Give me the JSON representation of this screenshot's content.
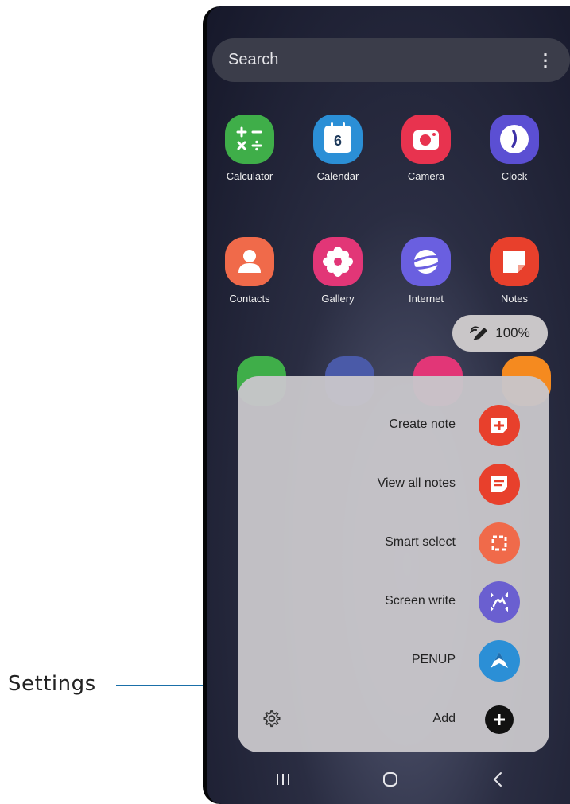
{
  "annotation": {
    "label": "Settings",
    "line_color": "#1a6fa8"
  },
  "search": {
    "placeholder": "Search",
    "more_icon": "more-vert-icon"
  },
  "apps": [
    {
      "label": "Calculator",
      "icon": "calculator-icon",
      "color": "#3fae49"
    },
    {
      "label": "Calendar",
      "icon": "calendar-icon",
      "color": "#2b8fd6",
      "day": "6"
    },
    {
      "label": "Camera",
      "icon": "camera-icon",
      "color": "#e8334f"
    },
    {
      "label": "Clock",
      "icon": "clock-icon",
      "color": "#5b4fd3"
    },
    {
      "label": "Contacts",
      "icon": "contacts-icon",
      "color": "#f06a4a"
    },
    {
      "label": "Gallery",
      "icon": "gallery-icon",
      "color": "#e23677"
    },
    {
      "label": "Internet",
      "icon": "internet-icon",
      "color": "#6a5fe0"
    },
    {
      "label": "Notes",
      "icon": "notes-icon",
      "color": "#e8402c"
    }
  ],
  "spen_battery": {
    "icon": "s-pen-icon",
    "value": "100%"
  },
  "air_command": {
    "items": [
      {
        "label": "Create note",
        "icon": "create-note-icon",
        "color": "#e8402c"
      },
      {
        "label": "View all notes",
        "icon": "view-notes-icon",
        "color": "#e8402c"
      },
      {
        "label": "Smart select",
        "icon": "smart-select-icon",
        "color": "#f06a4a"
      },
      {
        "label": "Screen write",
        "icon": "screen-write-icon",
        "color": "#6a5fd0"
      },
      {
        "label": "PENUP",
        "icon": "penup-icon",
        "color": "#2b8fd6"
      },
      {
        "label": "Add",
        "icon": "add-icon",
        "color": "#111111"
      }
    ],
    "settings_icon": "gear-icon"
  },
  "navbar": {
    "recents": "recents-icon",
    "home": "home-icon",
    "back": "back-icon"
  }
}
